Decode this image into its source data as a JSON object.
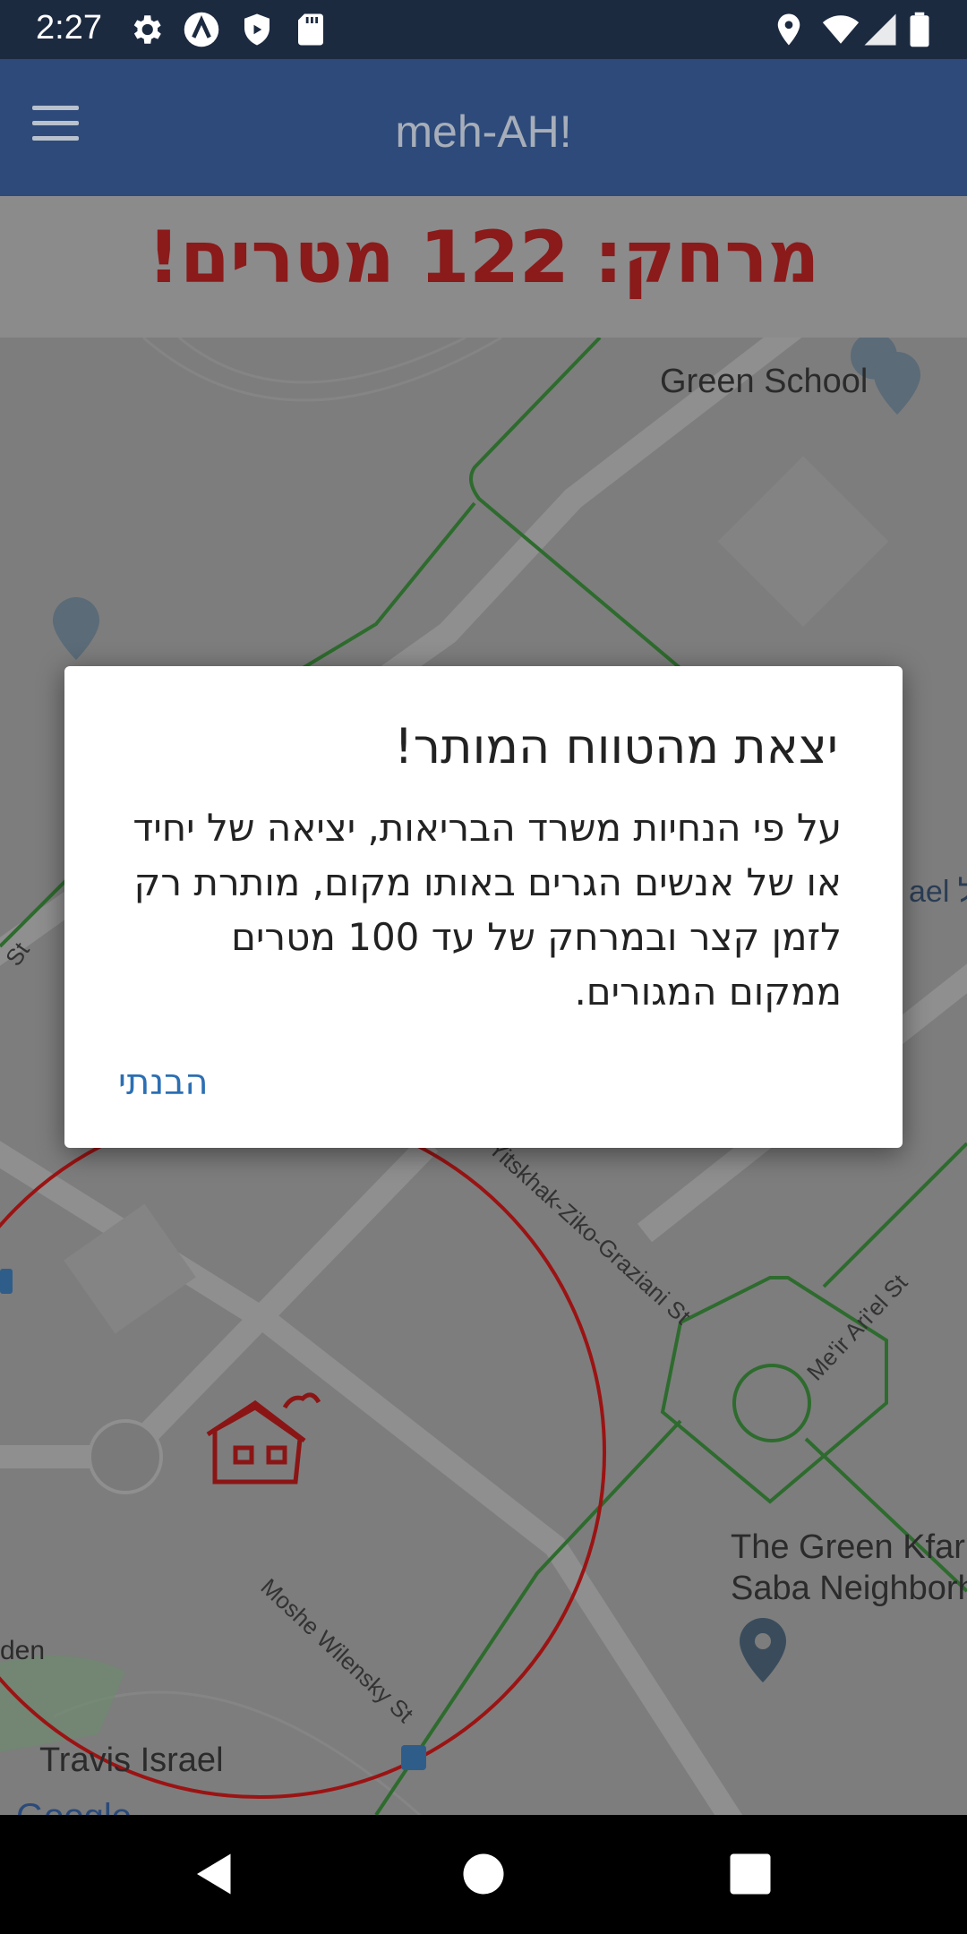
{
  "status_bar": {
    "time": "2:27",
    "icons": [
      "settings-icon",
      "app-a-icon",
      "shield-icon",
      "sd-card-icon",
      "location-icon",
      "wifi-icon",
      "signal-icon",
      "battery-icon"
    ]
  },
  "app_bar": {
    "title": "meh-AH!",
    "menu_icon": "menu-icon"
  },
  "distance_banner": {
    "text": "מרחק: 122 מטרים!"
  },
  "map": {
    "labels": {
      "green_school": "Green School",
      "green_kfar_saba_line1": "The Green Kfar",
      "green_kfar_saba_line2": "Saba Neighborh",
      "travis_israel": "Travis Israel",
      "garden_fragment": "den",
      "israel_fragment": "ael אל",
      "st_fragment": "St",
      "google": "Google"
    },
    "streets": {
      "yitzhak": "Yitskhak-Ziko-Graziani St",
      "meir": "Me'ir Ari'el St",
      "moshe": "Moshe Wilensky St"
    },
    "colors": {
      "circle": "#9b1313",
      "road_path": "#2e7d32"
    }
  },
  "dialog": {
    "title": "יצאת מהטווח המותר!",
    "body": "על פי הנחיות משרד הבריאות, יציאה של יחיד או של אנשים הגרים באותו מקום, מותרת רק לזמן קצר ובמרחק של עד 100 מטרים ממקום המגורים.",
    "button": "הבנתי"
  },
  "nav_bar": {
    "back": "back-icon",
    "home": "home-icon",
    "recents": "recents-icon"
  }
}
